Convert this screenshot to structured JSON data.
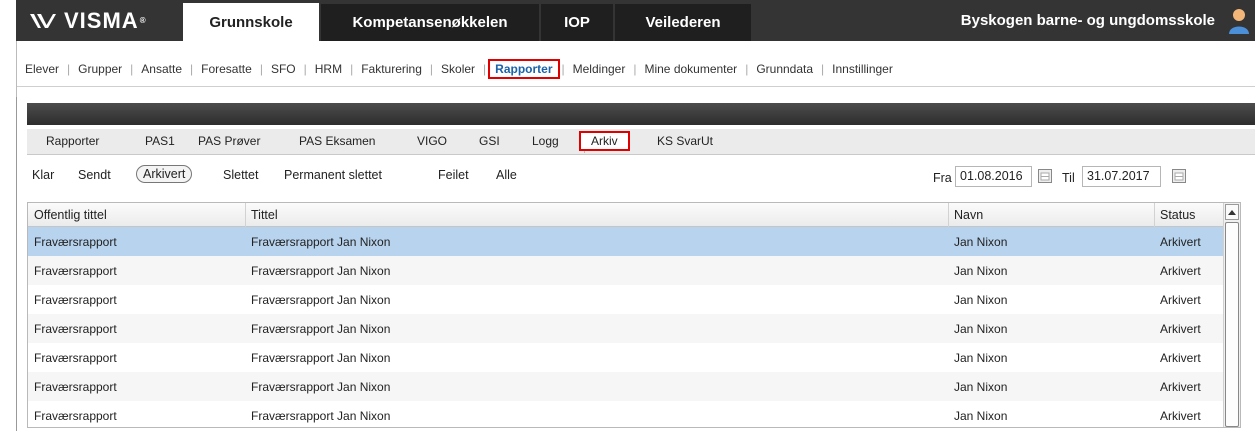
{
  "topbar": {
    "logo": "VISMA",
    "tabs": [
      {
        "label": "Grunnskole",
        "active": true
      },
      {
        "label": "Kompetansenøkkelen",
        "active": false
      },
      {
        "label": "IOP",
        "active": false
      },
      {
        "label": "Veilederen",
        "active": false
      }
    ],
    "school": "Byskogen barne- og ungdomsskole"
  },
  "subnav": {
    "items": [
      "Elever",
      "Grupper",
      "Ansatte",
      "Foresatte",
      "SFO",
      "HRM",
      "Fakturering",
      "Skoler",
      "Rapporter",
      "Meldinger",
      "Mine dokumenter",
      "Grunndata",
      "Innstillinger"
    ],
    "active": "Rapporter"
  },
  "report_tabs": {
    "items": [
      "Rapporter",
      "PAS1",
      "PAS Prøver",
      "PAS Eksamen",
      "VIGO",
      "GSI",
      "Logg",
      "Arkiv",
      "KS SvarUt"
    ],
    "active": "Arkiv"
  },
  "filters": {
    "items": [
      "Klar",
      "Sendt",
      "Arkivert",
      "Slettet",
      "Permanent slettet",
      "Feilet",
      "Alle"
    ],
    "active": "Arkivert",
    "from_label": "Fra",
    "from_value": "01.08.2016",
    "to_label": "Til",
    "to_value": "31.07.2017"
  },
  "table": {
    "columns": [
      "Offentlig tittel",
      "Tittel",
      "Navn",
      "Status"
    ],
    "rows": [
      [
        "Fraværsrapport",
        "Fraværsrapport Jan Nixon",
        "Jan Nixon",
        "Arkivert"
      ],
      [
        "Fraværsrapport",
        "Fraværsrapport Jan Nixon",
        "Jan Nixon",
        "Arkivert"
      ],
      [
        "Fraværsrapport",
        "Fraværsrapport Jan Nixon",
        "Jan Nixon",
        "Arkivert"
      ],
      [
        "Fraværsrapport",
        "Fraværsrapport Jan Nixon",
        "Jan Nixon",
        "Arkivert"
      ],
      [
        "Fraværsrapport",
        "Fraværsrapport Jan Nixon",
        "Jan Nixon",
        "Arkivert"
      ],
      [
        "Fraværsrapport",
        "Fraværsrapport Jan Nixon",
        "Jan Nixon",
        "Arkivert"
      ],
      [
        "Fraværsrapport",
        "Fraværsrapport Jan Nixon",
        "Jan Nixon",
        "Arkivert"
      ]
    ],
    "selected_row": 0
  },
  "colors": {
    "topbar": "#343434",
    "highlight": "#e00000",
    "selected_row": "#b8d3ee",
    "link_active": "#1a62a9"
  }
}
